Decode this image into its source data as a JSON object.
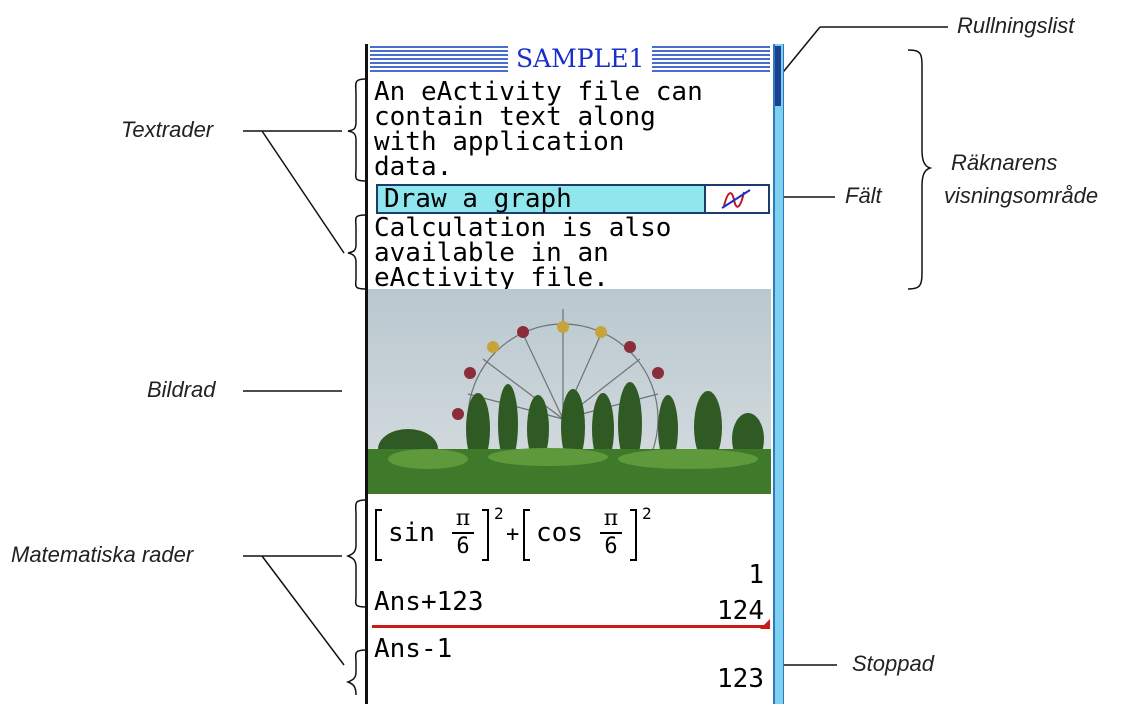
{
  "labels": {
    "scrollbar": "Rullningslist",
    "text_lines": "Textrader",
    "display_area_line1": "Räknarens",
    "display_area_line2": "visningsområde",
    "field": "Fält",
    "image_line": "Bildrad",
    "math_lines": "Matematiska rader",
    "stop_line": "Stoppad"
  },
  "screen": {
    "title": "SAMPLE1",
    "text_block1": [
      "An eActivity file can",
      "contain text along",
      "with application",
      "data."
    ],
    "field_label": "Draw a graph",
    "text_block2": [
      "Calculation is also",
      "available in an",
      "eActivity file."
    ],
    "math": {
      "expr_sin": "sin",
      "expr_cos": "cos",
      "pi": "π",
      "six": "6",
      "exp": "2",
      "plus": "+",
      "result1": "1",
      "ans_plus": "Ans+123",
      "result2": "124",
      "ans_minus": "Ans-1",
      "result3": "123"
    }
  },
  "colors": {
    "title_stripes": "#4a6ed0",
    "field_bg": "#8fe6ec",
    "stop_line": "#cc1a1a",
    "scrollbar": "#7fd0ee"
  }
}
